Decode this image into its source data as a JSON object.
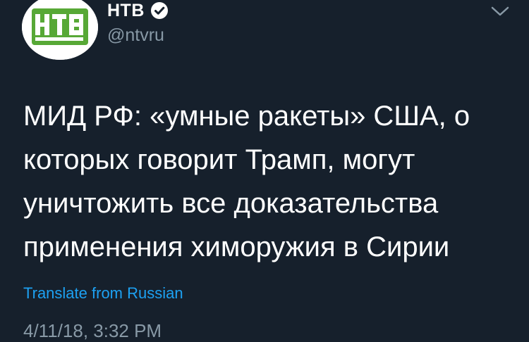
{
  "author": {
    "display_name": "НТВ",
    "handle": "@ntvru",
    "verified": true,
    "avatar_logo_text": "НТВ"
  },
  "tweet": {
    "lines": [
      "МИД РФ: «умные ракеты» США, о",
      "которых говорит Трамп, могут",
      "уничтожить все доказательства",
      "применения химоружия в Сирии"
    ],
    "translate_label": "Translate from Russian",
    "timestamp": "4/11/18, 3:32 PM"
  },
  "icons": {
    "verified": "verified-badge-icon",
    "menu": "chevron-down-icon"
  },
  "colors": {
    "background": "#16202c",
    "text": "#ffffff",
    "secondary": "#8899a6",
    "link": "#1da1f2",
    "logo_green": "#57a836"
  }
}
